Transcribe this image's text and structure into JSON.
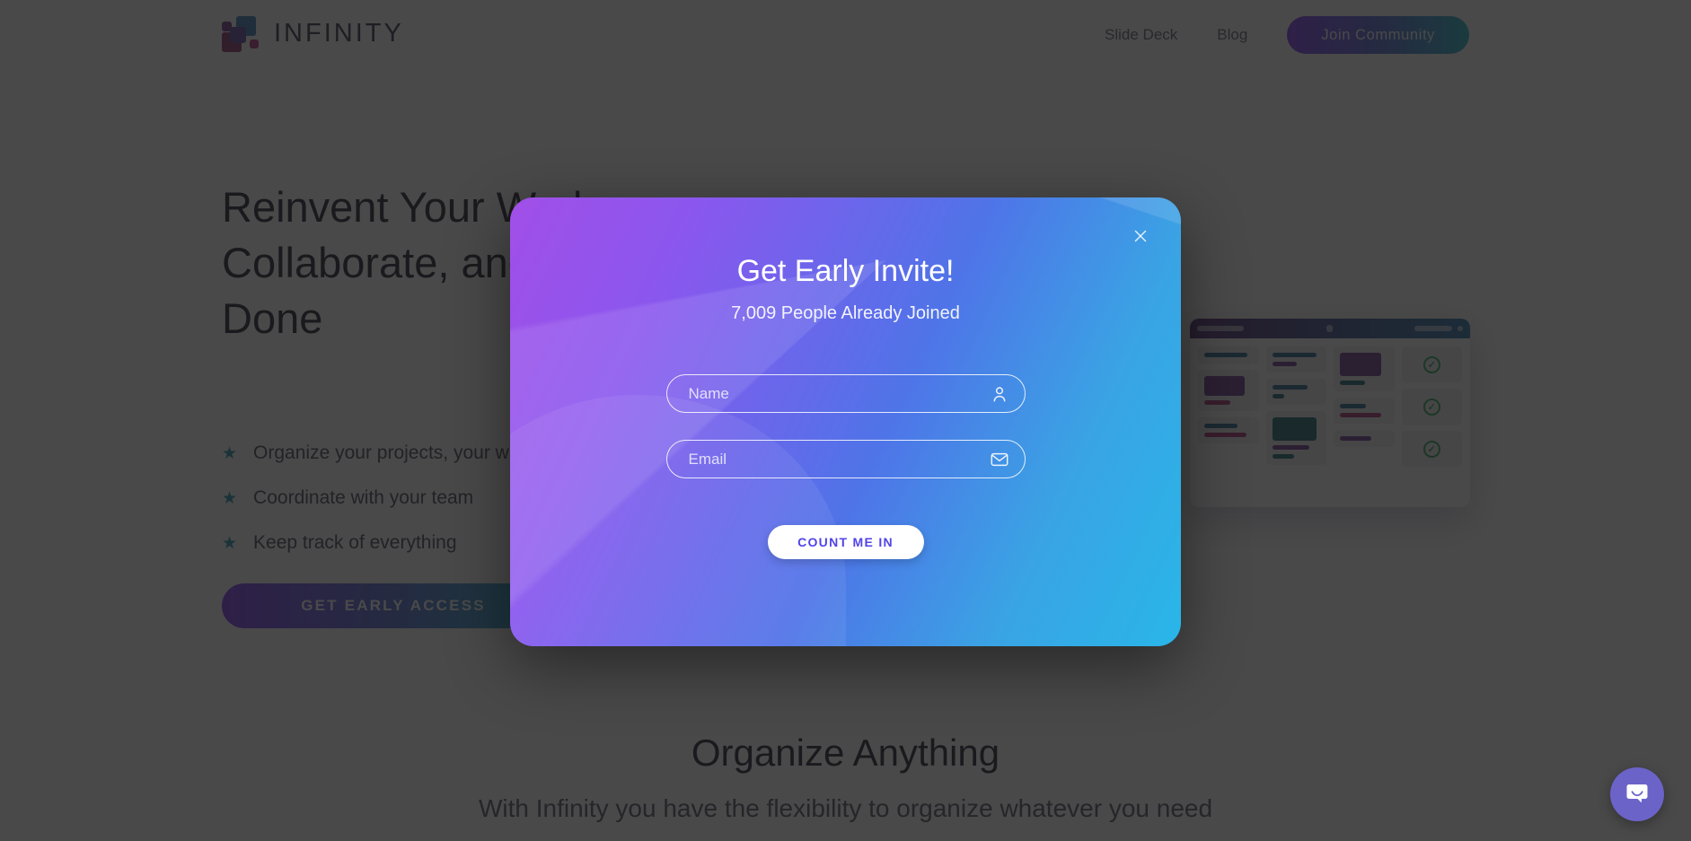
{
  "header": {
    "logo_text": "INFINITY",
    "logo_icon": "infinity-blocks-logo-icon",
    "nav": [
      {
        "label": "Slide Deck"
      },
      {
        "label": "Blog"
      }
    ],
    "cta_label": "Join Community",
    "cta_color": "#7b2ff7"
  },
  "hero": {
    "title": "Reinvent Your Workspace, Collaborate, and Get Things Done",
    "bullets": [
      {
        "icon": "star-icon",
        "text": "Organize your projects, your way"
      },
      {
        "icon": "star-icon",
        "text": "Coordinate with your team"
      },
      {
        "icon": "star-icon",
        "text": "Keep track of everything"
      }
    ],
    "cta_label": "GET EARLY ACCESS",
    "star_color": "#1a8fa8"
  },
  "mockup": {
    "name": "app-board-screenshot",
    "check_icon": "check-circle-icon",
    "check_color": "#23a455"
  },
  "section": {
    "title": "Organize Anything",
    "subtitle": "With Infinity you have the flexibility to organize whatever you need"
  },
  "modal": {
    "title": "Get Early Invite!",
    "subtitle": "7,009 People Already Joined",
    "close_icon": "close-icon",
    "fields": [
      {
        "name": "name-input",
        "placeholder": "Name",
        "value": "",
        "icon": "person-icon"
      },
      {
        "name": "email-input",
        "placeholder": "Email",
        "value": "",
        "icon": "envelope-icon"
      }
    ],
    "submit_label": "COUNT ME IN",
    "submit_text_color": "#5143e8",
    "gradient_start": "#a14fe8",
    "gradient_end": "#29b6e8"
  },
  "intercom": {
    "icon": "chat-bubble-smile-icon",
    "color": "#6c63c9"
  }
}
